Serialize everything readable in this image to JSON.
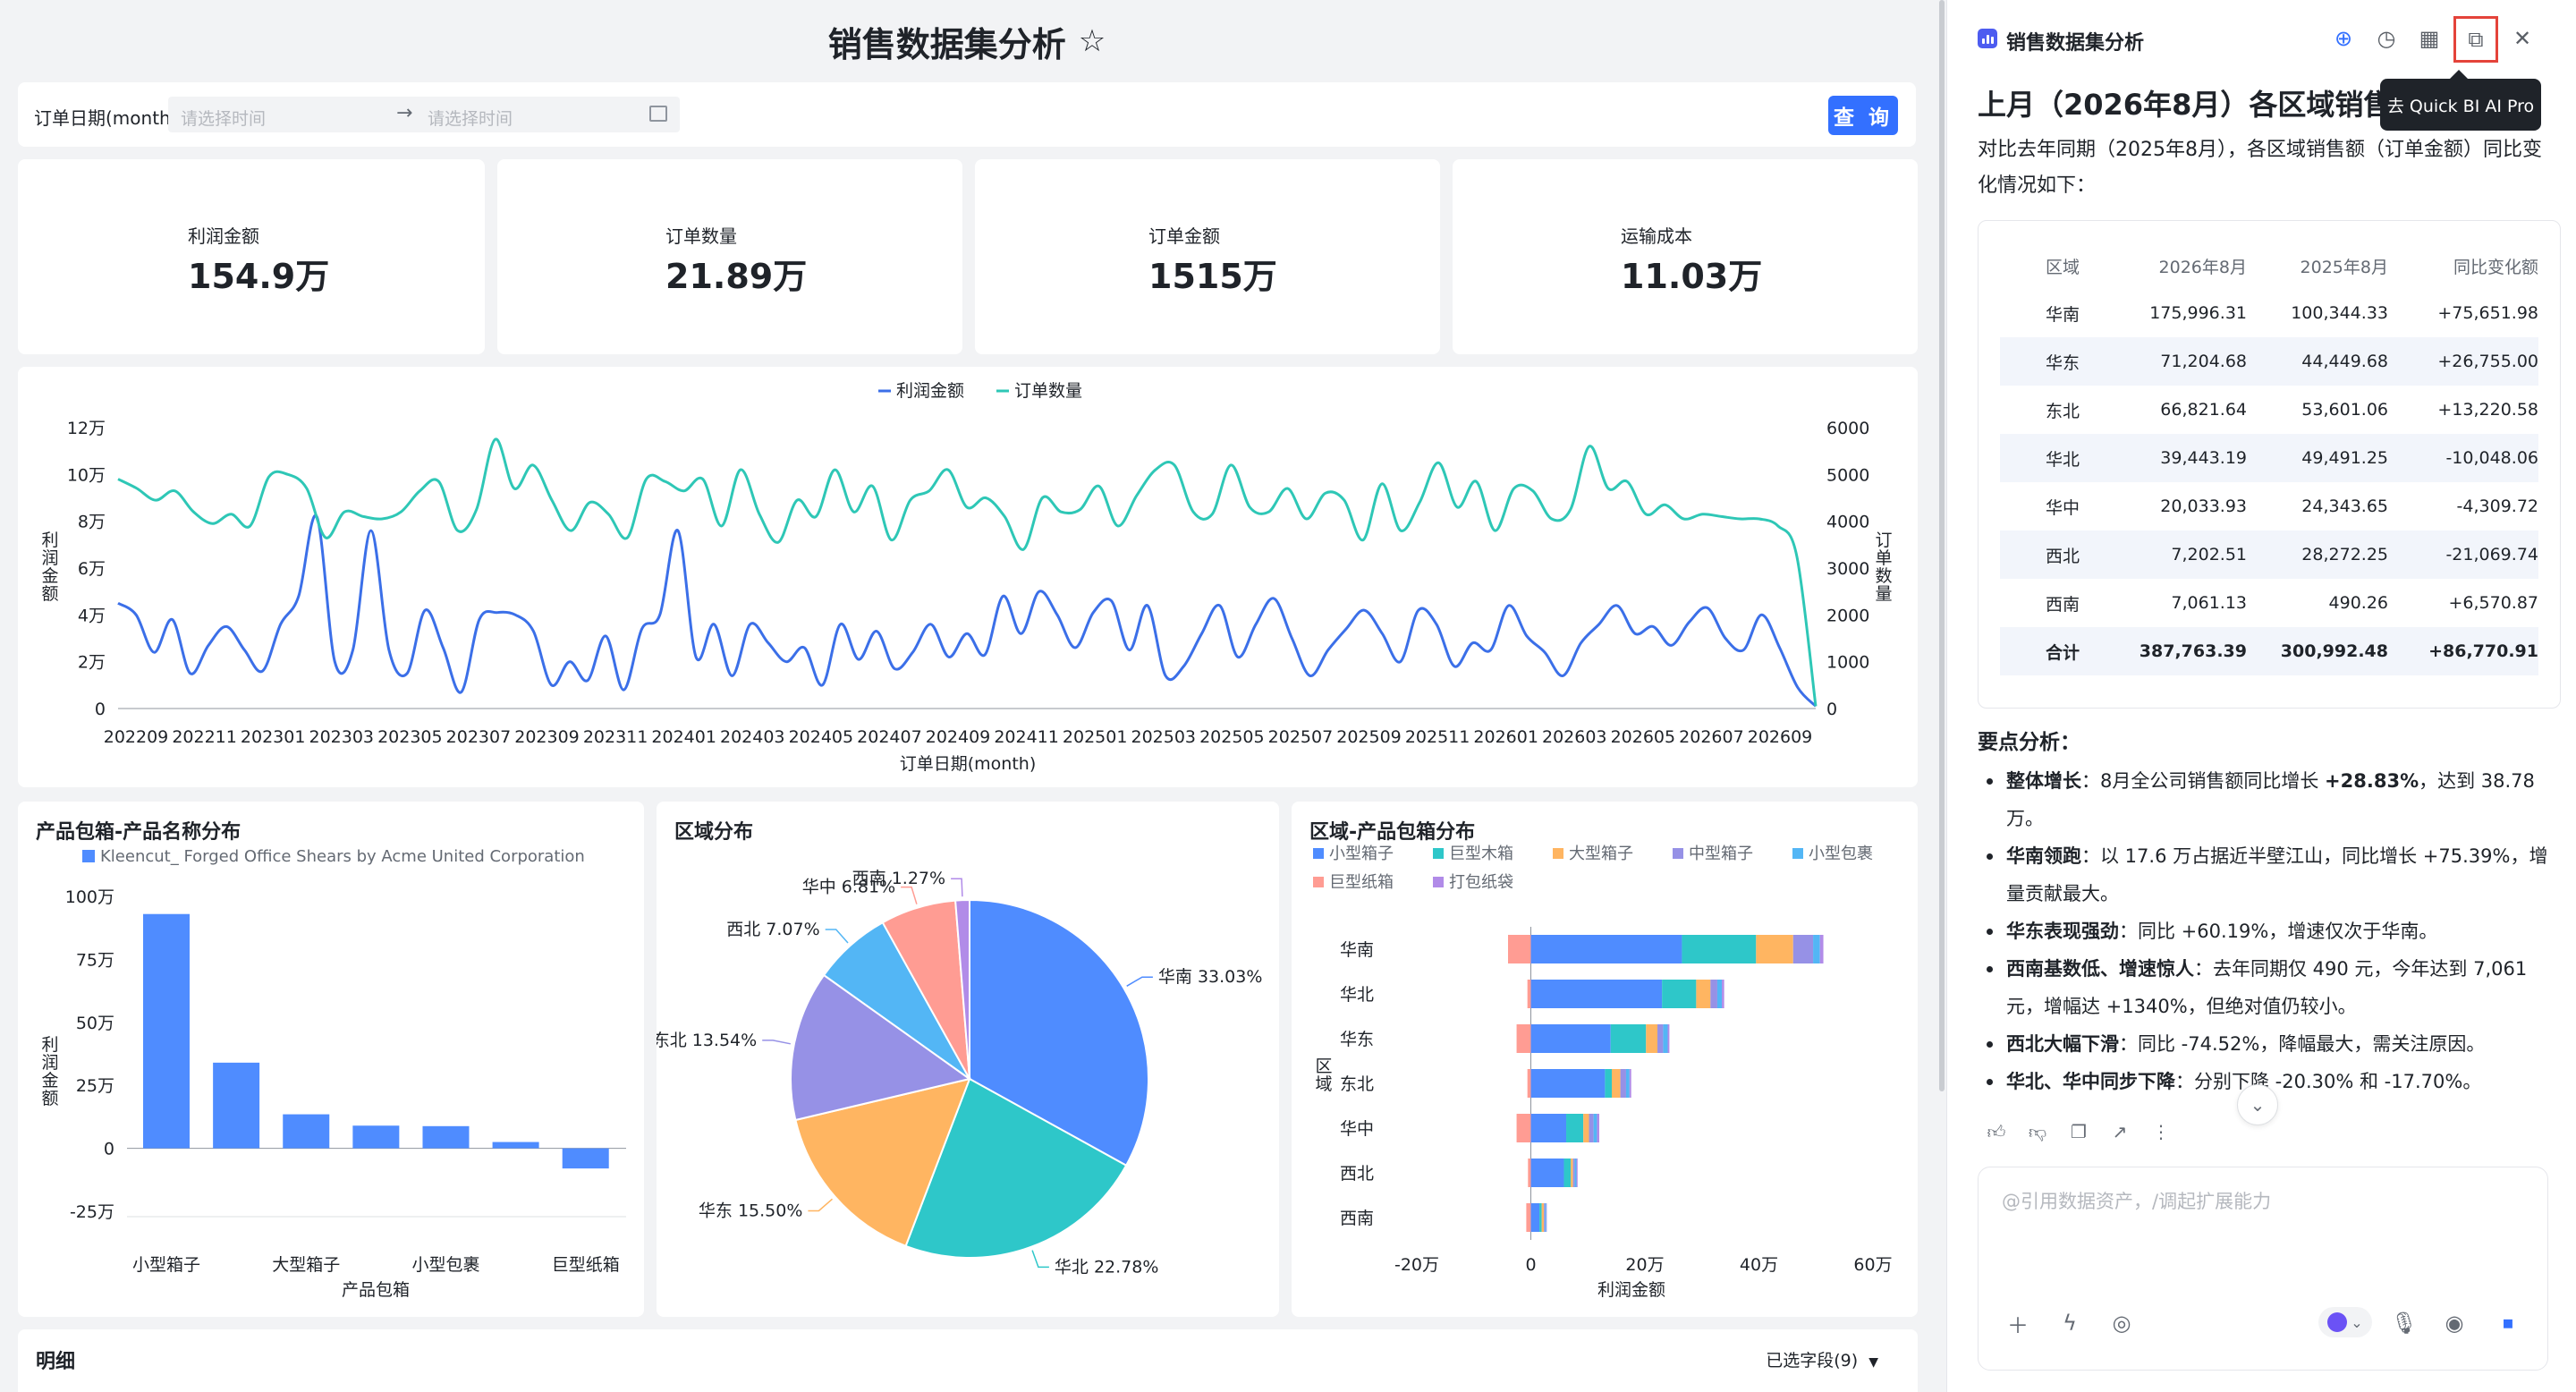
{
  "dashboard": {
    "title": "销售数据集分析",
    "star_icon": "star-outline-icon",
    "filter": {
      "label": "订单日期(month)",
      "start_placeholder": "请选择时间",
      "end_placeholder": "请选择时间",
      "query_label": "查 询"
    },
    "kpis": [
      {
        "label": "利润金额",
        "value": "154.9万"
      },
      {
        "label": "订单数量",
        "value": "21.89万"
      },
      {
        "label": "订单金额",
        "value": "1515万"
      },
      {
        "label": "运输成本",
        "value": "11.03万"
      }
    ],
    "detail": {
      "title": "明细",
      "fields_label": "已选字段(9)"
    }
  },
  "chart_data": [
    {
      "type": "line",
      "legend": [
        "利润金额",
        "订单数量"
      ],
      "xlabel": "订单日期(month)",
      "ylabel_left": "利润金额",
      "ylabel_right": "订单数量",
      "ylim_left": [
        0,
        120000
      ],
      "ylim_right": [
        0,
        6000
      ],
      "y_ticks_left": [
        "0",
        "2万",
        "4万",
        "6万",
        "8万",
        "10万",
        "12万"
      ],
      "y_ticks_right": [
        "0",
        "1000",
        "2000",
        "3000",
        "4000",
        "5000",
        "6000"
      ],
      "x_ticks": [
        "202209",
        "202211",
        "202301",
        "202303",
        "202305",
        "202307",
        "202309",
        "202311",
        "202401",
        "202403",
        "202405",
        "202407",
        "202409",
        "202411",
        "202501",
        "202503",
        "202505",
        "202507",
        "202509",
        "202511",
        "202601",
        "202603",
        "202605",
        "202607",
        "202609"
      ],
      "x_months": [
        "202209",
        "202210",
        "202211",
        "202212",
        "202301",
        "202302",
        "202303",
        "202304",
        "202305",
        "202306",
        "202307",
        "202308",
        "202309",
        "202310",
        "202311",
        "202312",
        "202401",
        "202402",
        "202403",
        "202404",
        "202405",
        "202406",
        "202407",
        "202408",
        "202409",
        "202410",
        "202411",
        "202412",
        "202501",
        "202502",
        "202503",
        "202504",
        "202505",
        "202506",
        "202507",
        "202508",
        "202509",
        "202510",
        "202511",
        "202512",
        "202601",
        "202602",
        "202603",
        "202604",
        "202605",
        "202606",
        "202607",
        "202608",
        "202609"
      ],
      "colors": {
        "利润金额": "#3b6fe8",
        "订单数量": "#2ec7b6"
      },
      "series": [
        {
          "name": "利润金额",
          "axis": "left",
          "values": [
            45000,
            40000,
            24000,
            38000,
            15000,
            27000,
            35000,
            25000,
            16000,
            36000,
            48000,
            82000,
            20000,
            25000,
            76000,
            25000,
            15000,
            42000,
            26000,
            7000,
            38000,
            41000,
            40000,
            33000,
            10000,
            20000,
            12000,
            31000,
            8000,
            34000,
            40000,
            76000,
            22000,
            36000,
            14000,
            36000,
            28000,
            20000,
            26000,
            10000,
            36000,
            21000,
            33000,
            17000,
            24000,
            36000,
            22000,
            32000,
            23000,
            48000,
            32000,
            50000,
            40000,
            26000,
            41000,
            46000,
            25000,
            44000,
            14000,
            18000,
            32000,
            44000,
            22000,
            36000,
            47000,
            30000,
            14000,
            25000,
            34000,
            42000,
            32000,
            20000,
            42000,
            36000,
            18000,
            28000,
            25000,
            44000,
            31000,
            24000,
            14000,
            28000,
            36000,
            44000,
            32000,
            35000,
            27000,
            37000,
            43000,
            30000,
            25000,
            40000,
            26000,
            9000,
            1000
          ]
        },
        {
          "name": "订单数量",
          "axis": "right",
          "values": [
            4900,
            4700,
            4450,
            4650,
            4200,
            3950,
            4150,
            3900,
            4950,
            5000,
            4700,
            3650,
            4200,
            4100,
            4050,
            4200,
            4650,
            4850,
            3800,
            4250,
            5750,
            4700,
            5200,
            4450,
            3800,
            4400,
            4150,
            3650,
            4900,
            4850,
            4650,
            4900,
            3900,
            5100,
            4150,
            3550,
            4450,
            4100,
            5100,
            4200,
            4750,
            3600,
            4450,
            4650,
            5100,
            4300,
            4500,
            4100,
            3400,
            4500,
            4200,
            4250,
            4750,
            3900,
            4550,
            5100,
            5200,
            4200,
            4150,
            5200,
            4300,
            4200,
            4700,
            4050,
            4600,
            4450,
            3600,
            4800,
            3800,
            4400,
            5250,
            4300,
            4850,
            3800,
            4700,
            4650,
            4050,
            4250,
            5600,
            4700,
            4850,
            4150,
            4350,
            4050,
            4150,
            4100,
            4050,
            4050,
            3900,
            3250,
            50
          ]
        }
      ]
    },
    {
      "type": "bar",
      "title": "产品包箱-产品名称分布",
      "legend": [
        "Kleencut_ Forged Office Shears by Acme United Corporation"
      ],
      "xlabel": "产品包箱",
      "ylabel": "利润金额",
      "ylim": [
        -250000,
        1000000
      ],
      "y_ticks": [
        "-25万",
        "0",
        "25万",
        "50万",
        "75万",
        "100万"
      ],
      "categories": [
        "小型箱子",
        "",
        "大型箱子",
        "",
        "小型包裹",
        "",
        "巨型纸箱"
      ],
      "values": [
        930000,
        340000,
        135000,
        90000,
        88000,
        25000,
        -80000
      ],
      "color": "#4f8cff"
    },
    {
      "type": "pie",
      "title": "区域分布",
      "slices": [
        {
          "label": "华南",
          "value": 33.03,
          "color": "#4f8cff"
        },
        {
          "label": "华北",
          "value": 22.78,
          "color": "#2ec7c9"
        },
        {
          "label": "华东",
          "value": 15.5,
          "color": "#ffb561"
        },
        {
          "label": "东北",
          "value": 13.54,
          "color": "#9691e6"
        },
        {
          "label": "西北",
          "value": 7.07,
          "color": "#53b6f5"
        },
        {
          "label": "华中",
          "value": 6.81,
          "color": "#ff9c93"
        },
        {
          "label": "西南",
          "value": 1.27,
          "color": "#b18be8"
        }
      ]
    },
    {
      "type": "bar",
      "orientation": "horizontal",
      "stacked": true,
      "title": "区域-产品包箱分布",
      "xlabel": "利润金额",
      "ylabel": "区域",
      "xlim": [
        -200000,
        600000
      ],
      "x_ticks": [
        "-20万",
        "0",
        "20万",
        "40万",
        "60万"
      ],
      "categories": [
        "华南",
        "华北",
        "华东",
        "东北",
        "华中",
        "西北",
        "西南"
      ],
      "series": [
        {
          "name": "小型箱子",
          "color": "#4f8cff",
          "values": [
            265000,
            230000,
            140000,
            130000,
            62000,
            58000,
            15000
          ]
        },
        {
          "name": "巨型木箱",
          "color": "#2ec7c9",
          "values": [
            130000,
            60000,
            62000,
            12000,
            30000,
            12000,
            4000
          ]
        },
        {
          "name": "大型箱子",
          "color": "#ffb561",
          "values": [
            65000,
            25000,
            20000,
            15000,
            10000,
            4000,
            4000
          ]
        },
        {
          "name": "中型箱子",
          "color": "#9691e6",
          "values": [
            35000,
            12000,
            10000,
            10000,
            8000,
            3000,
            2000
          ]
        },
        {
          "name": "小型包裹",
          "color": "#53b6f5",
          "values": [
            12000,
            8000,
            8000,
            6000,
            6000,
            3000,
            2000
          ]
        },
        {
          "name": "巨型纸箱",
          "color": "#ff9c93",
          "values": [
            -40000,
            -6000,
            -25000,
            -6000,
            -25000,
            -5000,
            -8000
          ]
        },
        {
          "name": "打包纸袋",
          "color": "#b18be8",
          "values": [
            6000,
            4000,
            3000,
            3000,
            4000,
            2000,
            1000
          ]
        }
      ]
    }
  ],
  "copilot": {
    "title": "销售数据集分析",
    "tooltip": "去 Quick BI AI Pro",
    "header_icons": [
      "new-chat-icon",
      "history-icon",
      "calendar-icon",
      "open-external-icon",
      "close-icon"
    ],
    "heading": "上月（2026年8月）各区域销售额同比分析",
    "intro": "对比去年同期（2025年8月），各区域销售额（订单金额）同比变化情况如下：",
    "table": {
      "headers": [
        "区域",
        "2026年8月",
        "2025年8月",
        "同比变化额"
      ],
      "rows": [
        [
          "华南",
          "175,996.31",
          "100,344.33",
          "+75,651.98"
        ],
        [
          "华东",
          "71,204.68",
          "44,449.68",
          "+26,755.00"
        ],
        [
          "东北",
          "66,821.64",
          "53,601.06",
          "+13,220.58"
        ],
        [
          "华北",
          "39,443.19",
          "49,491.25",
          "-10,048.06"
        ],
        [
          "华中",
          "20,033.93",
          "24,343.65",
          "-4,309.72"
        ],
        [
          "西北",
          "7,202.51",
          "28,272.25",
          "-21,069.74"
        ],
        [
          "西南",
          "7,061.13",
          "490.26",
          "+6,570.87"
        ],
        [
          "合计",
          "387,763.39",
          "300,992.48",
          "+86,770.91"
        ]
      ]
    },
    "key_title": "要点分析：",
    "points": [
      {
        "bold": "整体增长",
        "text": "：8月全公司销售额同比增长 ",
        "bold2": "+28.83%",
        "text2": "，达到 38.78 万。"
      },
      {
        "bold": "华南领跑",
        "text": "：以 17.6 万占据近半壁江山，同比增长 +75.39%，增量贡献最大。",
        "bold2": "",
        "text2": ""
      },
      {
        "bold": "华东表现强劲",
        "text": "：同比 +60.19%，增速仅次于华南。",
        "bold2": "",
        "text2": ""
      },
      {
        "bold": "西南基数低、增速惊人",
        "text": "：去年同期仅 490 元，今年达到 7,061 元，增幅达 +1340%，但绝对值仍较小。",
        "bold2": "",
        "text2": ""
      },
      {
        "bold": "西北大幅下滑",
        "text": "：同比 -74.52%，降幅最大，需关注原因。",
        "bold2": "",
        "text2": ""
      },
      {
        "bold": "华北、华中同步下降",
        "text": "：分别下降 -20.30% 和 -17.70%。",
        "bold2": "",
        "text2": ""
      }
    ],
    "input_placeholder": "@引用数据资产，/调起扩展能力"
  }
}
